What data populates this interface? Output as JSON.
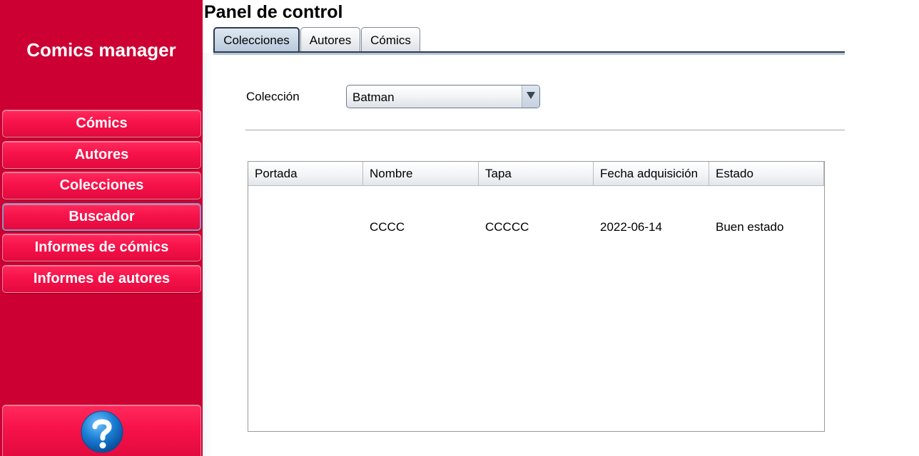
{
  "sidebar": {
    "app_title": "Comics manager",
    "items": [
      {
        "label": "Cómics"
      },
      {
        "label": "Autores"
      },
      {
        "label": "Colecciones"
      },
      {
        "label": "Buscador"
      },
      {
        "label": "Informes de cómics"
      },
      {
        "label": "Informes de autores"
      }
    ],
    "active_item": "Buscador",
    "help_icon": "question-mark-icon",
    "colors": {
      "background": "#cc0033",
      "button": "#f7124a",
      "help_icon": "#1b7ed4"
    }
  },
  "main": {
    "title": "Panel de control",
    "tabs": [
      {
        "label": "Colecciones"
      },
      {
        "label": "Autores"
      },
      {
        "label": "Cómics"
      }
    ],
    "active_tab": "Colecciones",
    "collection_label": "Colección",
    "collection_value": "Batman",
    "table": {
      "columns": [
        "Portada",
        "Nombre",
        "Tapa",
        "Fecha adquisición",
        "Estado"
      ],
      "rows": [
        [
          "",
          "CCCC",
          "CCCCC",
          "2022-06-14",
          "Buen estado"
        ]
      ]
    }
  }
}
